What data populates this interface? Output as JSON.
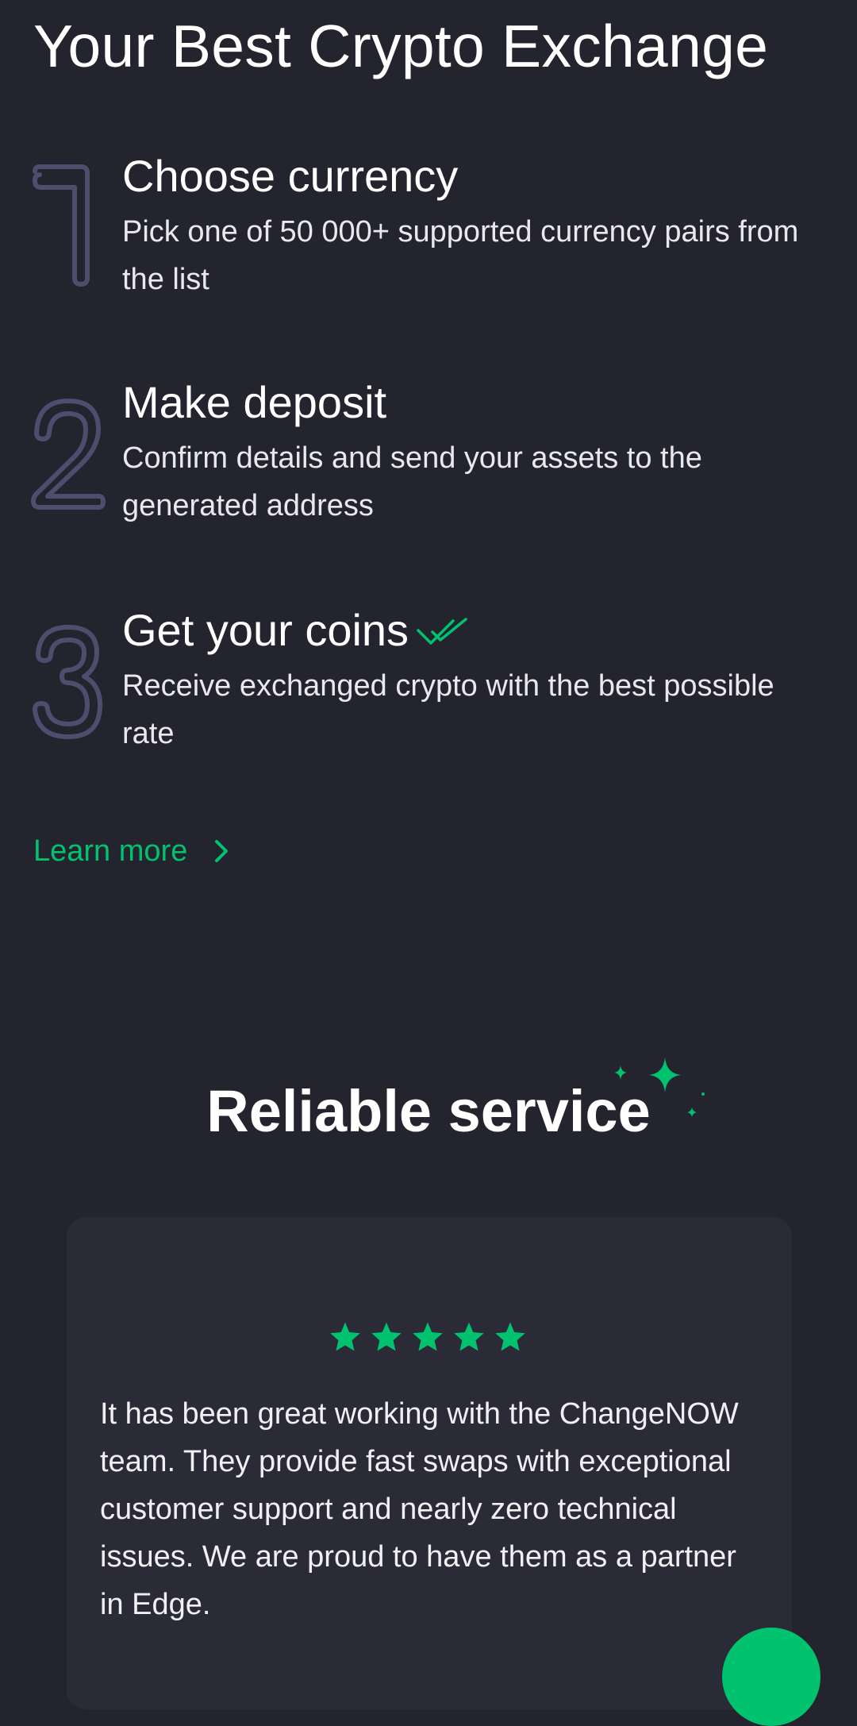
{
  "page": {
    "title": "Your Best Crypto Exchange"
  },
  "steps": [
    {
      "number": "1",
      "title": "Choose currency",
      "description": "Pick one of 50 000+ supported currency pairs from the list"
    },
    {
      "number": "2",
      "title": "Make deposit",
      "description": "Confirm details and send your assets to the generated address"
    },
    {
      "number": "3",
      "title": "Get your coins",
      "description": "Receive exchanged crypto with the best possible rate",
      "icon": "double-check-icon"
    }
  ],
  "learn_more": {
    "label": "Learn more",
    "icon": "chevron-right-icon"
  },
  "reliable": {
    "title": "Reliable service",
    "decoration_icon": "sparkles-icon"
  },
  "review": {
    "rating": 5,
    "rating_max": 5,
    "text": "It has been great working with the ChangeNOW team. They provide fast swaps with exceptional customer support and nearly zero technical issues. We are proud to have them as a partner in Edge."
  },
  "chat_button": {
    "icon": "chat-icon"
  },
  "colors": {
    "background": "#24242f",
    "card": "#2b2b37",
    "accent": "#00c26f",
    "step_number_outline": "#4f4c6e",
    "text": "#ffffff"
  }
}
